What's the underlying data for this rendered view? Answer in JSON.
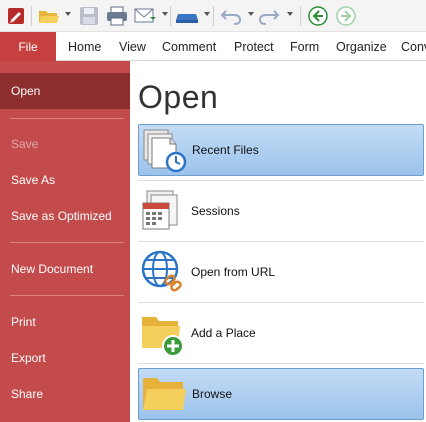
{
  "ribbon": {
    "file_label": "File",
    "tabs": [
      "Home",
      "View",
      "Comment",
      "Protect",
      "Form",
      "Organize",
      "Conv"
    ]
  },
  "sidebar": {
    "items": [
      {
        "label": "Open",
        "state": "active"
      },
      {
        "label": "Save",
        "state": "disabled"
      },
      {
        "label": "Save As",
        "state": "normal"
      },
      {
        "label": "Save as Optimized",
        "state": "normal"
      },
      {
        "label": "New Document",
        "state": "normal"
      },
      {
        "label": "Print",
        "state": "normal"
      },
      {
        "label": "Export",
        "state": "normal"
      },
      {
        "label": "Share",
        "state": "normal"
      }
    ]
  },
  "main": {
    "title": "Open",
    "options": [
      {
        "label": "Recent Files",
        "icon": "recent-files-icon",
        "selected": true
      },
      {
        "label": "Sessions",
        "icon": "sessions-icon",
        "selected": false
      },
      {
        "label": "Open from URL",
        "icon": "globe-link-icon",
        "selected": false
      },
      {
        "label": "Add a Place",
        "icon": "add-folder-icon",
        "selected": false
      },
      {
        "label": "Browse",
        "icon": "folder-icon",
        "selected": true
      }
    ]
  },
  "colors": {
    "sidebar": "#c44b4b",
    "sidebar_active": "#8f2e2e",
    "file_tab": "#c6403f",
    "selection": "#9cc3ec"
  }
}
